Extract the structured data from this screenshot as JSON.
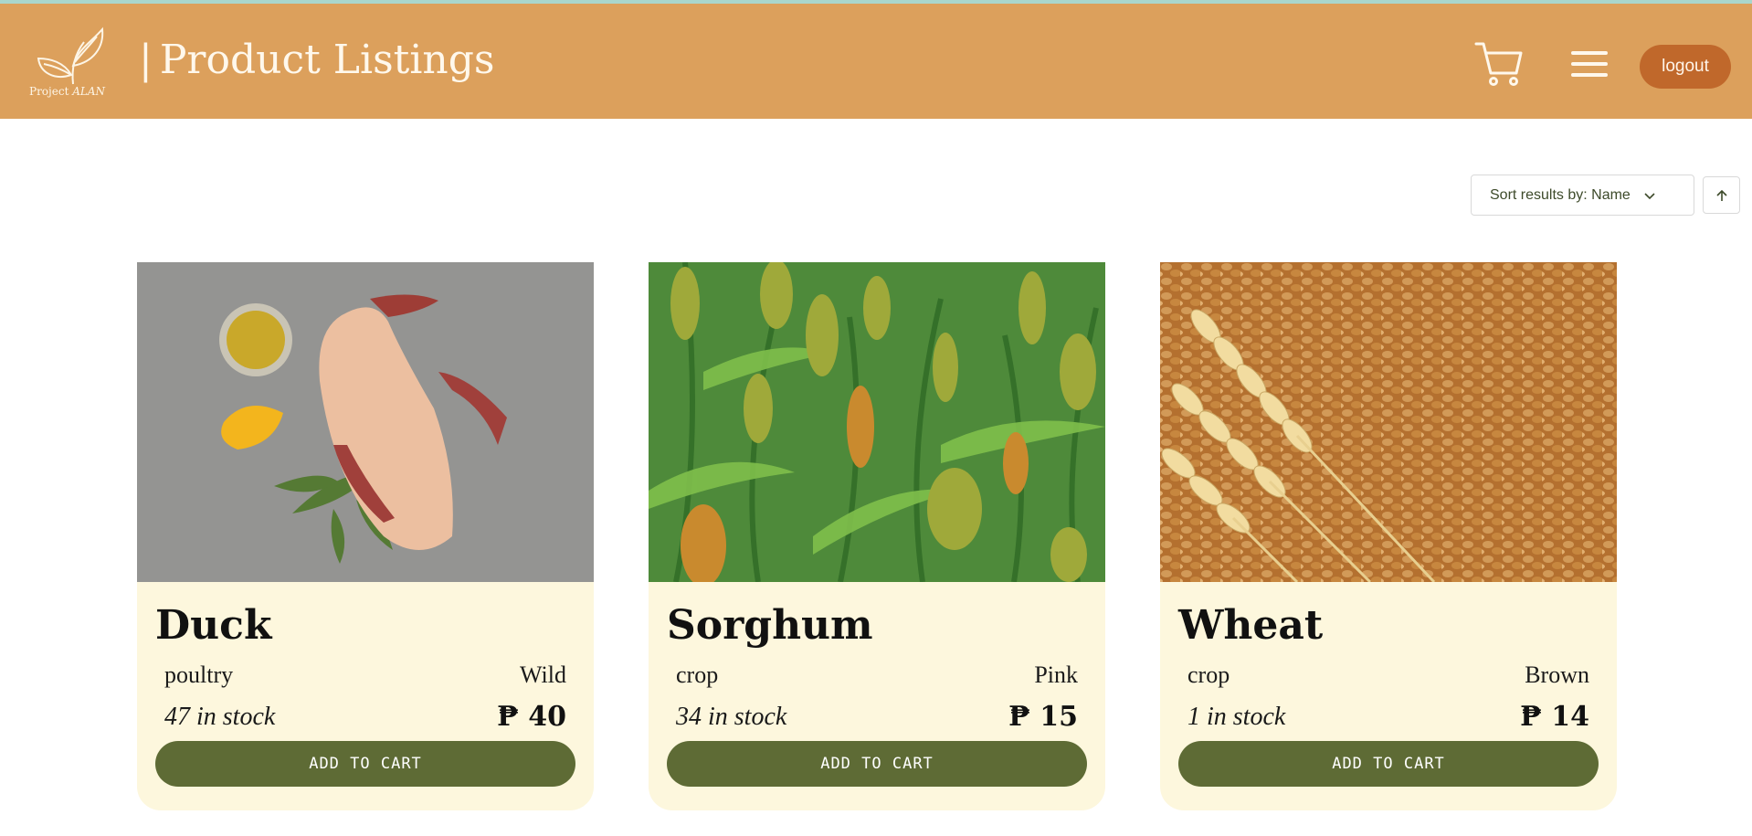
{
  "header": {
    "logo_text_main": "Project ",
    "logo_text_em": "ALAN",
    "separator": "|",
    "title": "Product Listings",
    "cart_icon": "cart-icon",
    "menu_icon": "hamburger-menu-icon",
    "logout_label": "logout"
  },
  "sort": {
    "label": "Sort results by: Name",
    "direction_icon": "arrow-up-icon"
  },
  "colors": {
    "header_bg": "#dca05c",
    "logout_bg": "#c0682b",
    "card_bg": "#fdf7dd",
    "button_bg": "#5e6b35"
  },
  "products": [
    {
      "name": "Duck",
      "category": "poultry",
      "variety": "Wild",
      "stock": "47 in stock",
      "price": "₱ 40",
      "button": "ADD TO CART"
    },
    {
      "name": "Sorghum",
      "category": "crop",
      "variety": "Pink",
      "stock": "34 in stock",
      "price": "₱ 15",
      "button": "ADD TO CART"
    },
    {
      "name": "Wheat",
      "category": "crop",
      "variety": "Brown",
      "stock": "1 in stock",
      "price": "₱ 14",
      "button": "ADD TO CART"
    }
  ]
}
